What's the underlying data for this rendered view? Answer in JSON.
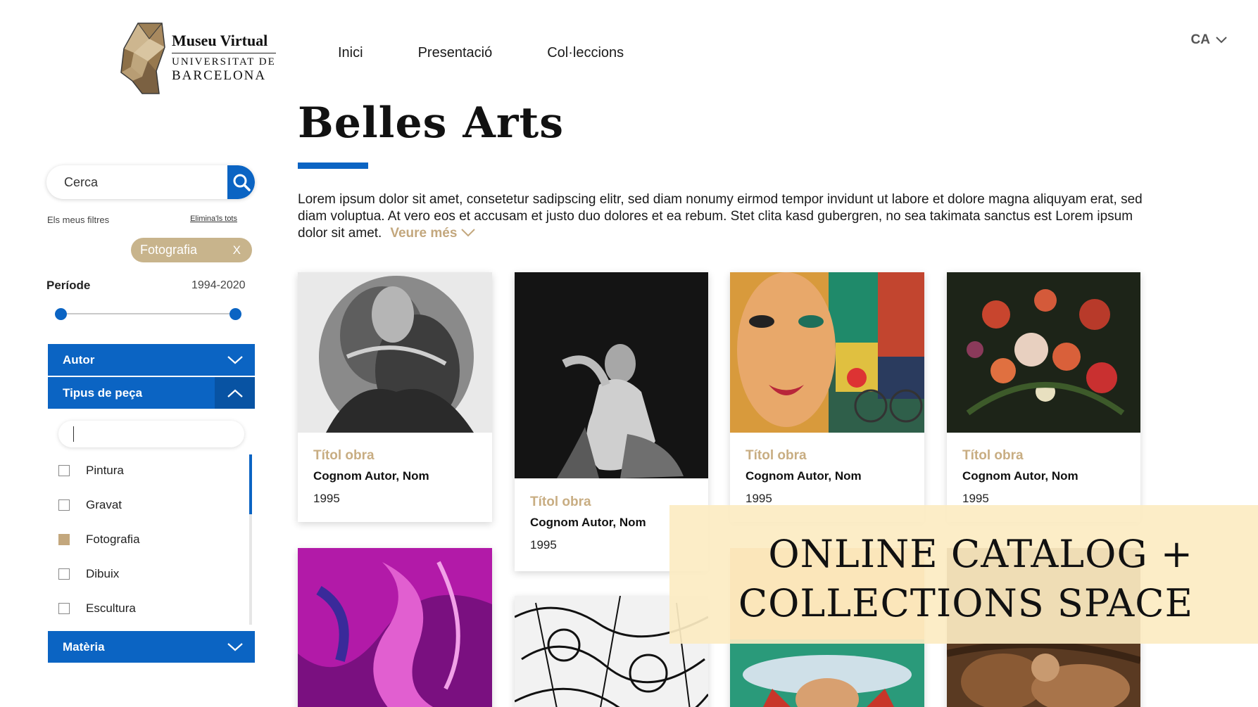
{
  "brand": {
    "title": "Museu Virtual",
    "sub1": "UNIVERSITAT DE",
    "sub2": "BARCELONA"
  },
  "nav": {
    "items": [
      "Inici",
      "Presentació",
      "Col·leccions"
    ]
  },
  "lang": {
    "current": "CA"
  },
  "page": {
    "title": "Belles Arts",
    "intro": "Lorem ipsum dolor sit amet, consetetur sadipscing elitr, sed diam nonumy eirmod tempor invidunt ut labore et dolore magna aliquyam erat, sed diam voluptua. At vero eos et accusam et justo duo dolores et ea rebum. Stet clita kasd gubergren, no sea takimata sanctus est Lorem ipsum dolor sit amet.",
    "more": "Veure més"
  },
  "sidebar": {
    "search_placeholder": "Cerca",
    "my_filters": "Els meus filtres",
    "clear_all": "Elimina'ls tots",
    "active_chip": "Fotografia",
    "chip_close": "X",
    "period_label": "Període",
    "period_value": "1994-2020",
    "period_min": 0,
    "period_max": 1,
    "sections": {
      "author": "Autor",
      "type": "Tipus de peça",
      "material": "Matèria"
    },
    "type_options": [
      {
        "label": "Pintura",
        "checked": false
      },
      {
        "label": "Gravat",
        "checked": false
      },
      {
        "label": "Fotografia",
        "checked": true
      },
      {
        "label": "Dibuix",
        "checked": false
      },
      {
        "label": "Escultura",
        "checked": false
      }
    ]
  },
  "cards": [
    {
      "title": "Títol obra",
      "author": "Cognom Autor, Nom",
      "year": "1995"
    },
    {
      "title": "Títol obra",
      "author": "Cognom Autor, Nom",
      "year": "1995"
    },
    {
      "title": "Títol obra",
      "author": "Cognom Autor, Nom",
      "year": "1995"
    },
    {
      "title": "Títol obra",
      "author": "Cognom Autor, Nom",
      "year": "1995"
    }
  ],
  "overlay": {
    "line1": "ONLINE CATALOG +",
    "line2": "COLLECTIONS SPACE"
  },
  "colors": {
    "primary": "#0b64c3",
    "accent": "#c3a77d",
    "overlay": "#fcecc2"
  }
}
